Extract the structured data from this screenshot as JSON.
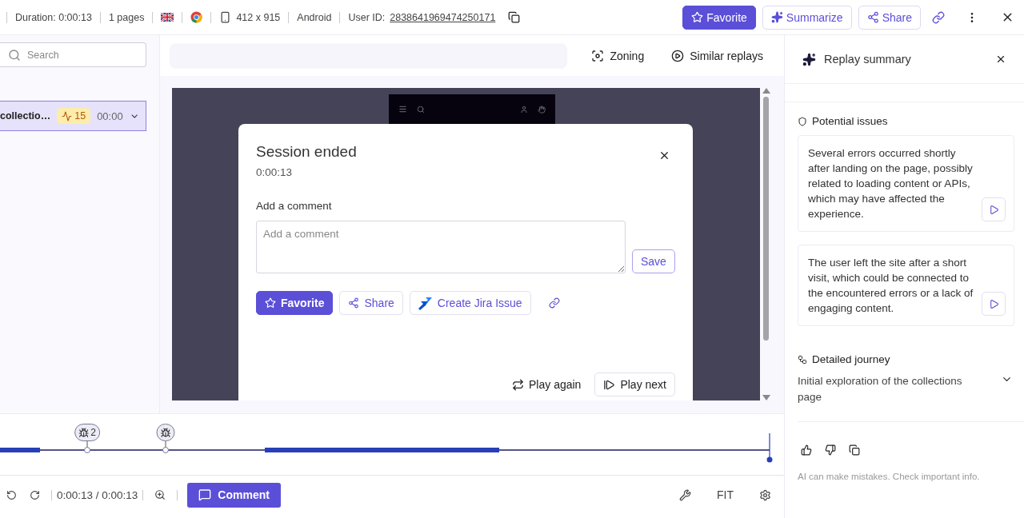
{
  "top_bar": {
    "items": [
      {
        "kind": "text",
        "text": "Duration: 0:00:13"
      },
      {
        "kind": "text",
        "text": "1 pages"
      },
      {
        "kind": "flag"
      },
      {
        "kind": "browser"
      },
      {
        "kind": "device",
        "text": "412 x 915"
      },
      {
        "kind": "text",
        "text": "Android"
      },
      {
        "kind": "user",
        "label": "User ID:",
        "text": "2838641969474250171"
      }
    ],
    "buttons": [
      {
        "kind": "primary",
        "label": "Favorite"
      },
      {
        "kind": "summarize",
        "label": "Summarize"
      },
      {
        "kind": "share",
        "label": "Share"
      }
    ]
  },
  "sidebar": {
    "search": {
      "placeholder": "Search"
    },
    "pages": [
      {
        "title": "collectio…",
        "events": "15",
        "time": "00:00",
        "selected": true
      }
    ]
  },
  "toolbar": {
    "tools": [
      {
        "kind": "zoning",
        "label": "Zoning"
      },
      {
        "kind": "similar",
        "label": "Similar replays"
      }
    ]
  },
  "modal": {
    "title": "Session ended",
    "time": "0:00:13",
    "comment_label": "Add a comment",
    "placeholder": "Add a comment",
    "save": "Save",
    "actions": [
      {
        "kind": "favorite",
        "label": "Favorite"
      },
      {
        "kind": "share",
        "label": "Share"
      },
      {
        "kind": "jira",
        "label": "Create Jira Issue"
      }
    ],
    "footer": [
      {
        "kind": "again",
        "label": "Play again"
      },
      {
        "kind": "next",
        "label": "Play next"
      }
    ]
  },
  "timeline": {
    "markers": [
      {
        "kind": "bug",
        "count": "2"
      },
      {
        "kind": "bug"
      }
    ]
  },
  "controls": {
    "time": "0:00:13 / 0:00:13",
    "comment": "Comment",
    "fit": "FIT"
  },
  "summary": {
    "title": "Replay summary",
    "issues_heading": "Potential issues",
    "issues": [
      {
        "text": "Several errors occurred shortly after landing on the page, possibly related to loading content or APIs, which may have affected the experience."
      },
      {
        "text": "The user left the site after a short visit, which could be connected to the encountered errors or a lack of engaging content."
      }
    ],
    "journey_heading": "Detailed journey",
    "journey": [
      {
        "text": "Initial exploration of the collections page",
        "expanded": false
      }
    ],
    "disclaimer": "AI can make mistakes. Check important info."
  }
}
